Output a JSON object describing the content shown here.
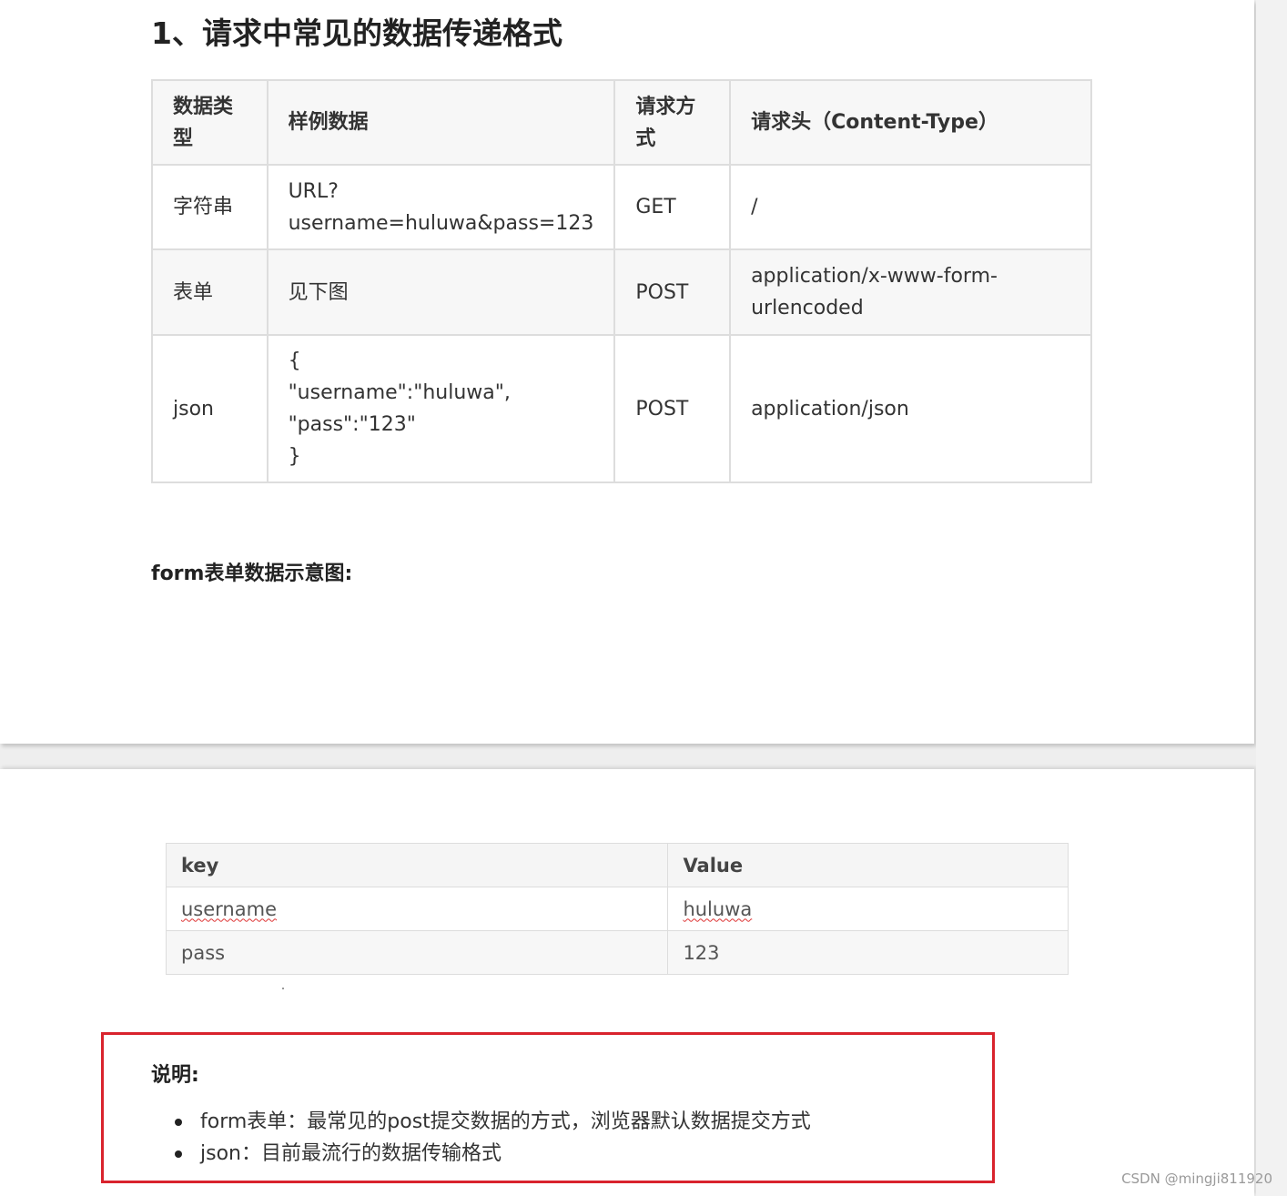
{
  "section_title": "1、请求中常见的数据传递格式",
  "format_table": {
    "headers": [
      "数据类型",
      "样例数据",
      "请求方式",
      "请求头（Content-Type）"
    ],
    "header_lines": {
      "type": [
        "数据类",
        "型"
      ],
      "method": [
        "请求方",
        "式"
      ]
    },
    "rows": [
      {
        "type": "字符串",
        "sample_lines": [
          "URL?",
          "username=huluwa&pass=123"
        ],
        "method": "GET",
        "content_type_lines": [
          "/"
        ]
      },
      {
        "type": "表单",
        "sample_lines": [
          "见下图"
        ],
        "method": "POST",
        "content_type_lines": [
          "application/x-www-form-",
          "urlencoded"
        ]
      },
      {
        "type": "json",
        "sample_lines": [
          "{",
          "\"username\":\"huluwa\",",
          "\"pass\":\"123\"",
          "}"
        ],
        "method": "POST",
        "content_type_lines": [
          "application/json"
        ]
      }
    ]
  },
  "form_caption": "form表单数据示意图:",
  "kv_table": {
    "headers": [
      "key",
      "Value"
    ],
    "rows": [
      [
        "username",
        "huluwa"
      ],
      [
        "pass",
        "123"
      ]
    ]
  },
  "note": {
    "title": "说明:",
    "items": [
      "form表单：最常见的post提交数据的方式，浏览器默认数据提交方式",
      "json：目前最流行的数据传输格式"
    ],
    "border_color": "#d9232d"
  },
  "watermark": "CSDN @mingji811920"
}
